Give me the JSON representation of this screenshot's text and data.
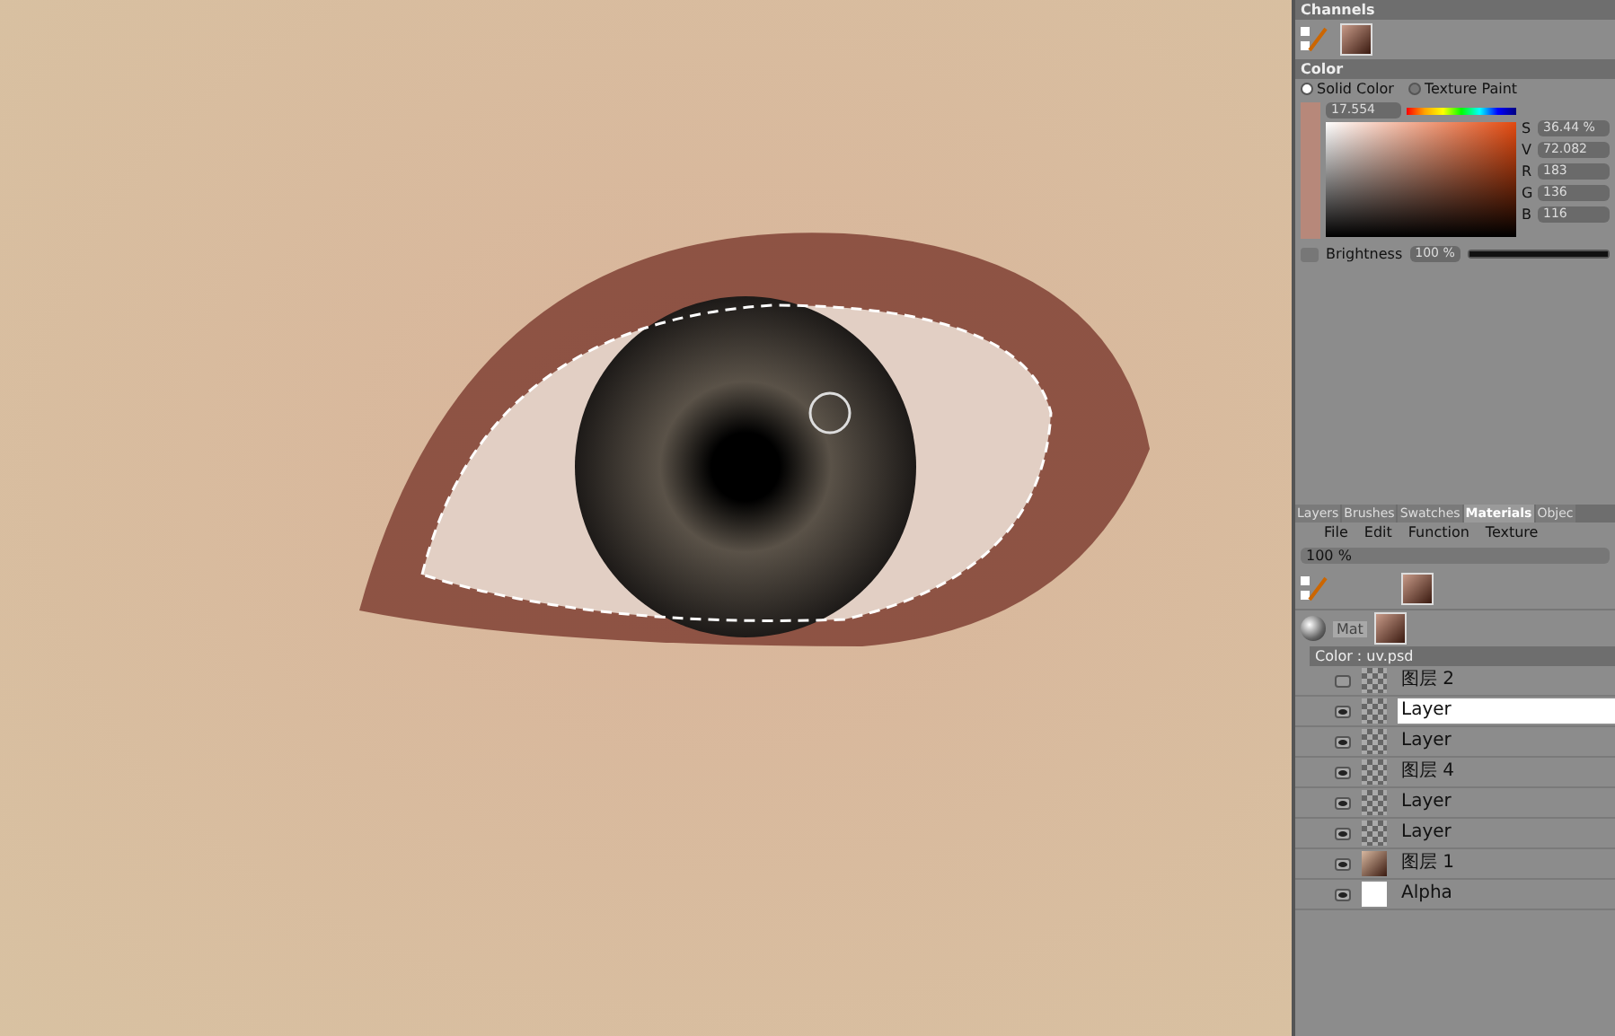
{
  "channels": {
    "title": "Channels"
  },
  "color": {
    "title": "Color",
    "modes": [
      {
        "label": "Solid Color",
        "selected": true
      },
      {
        "label": "Texture Paint",
        "selected": false
      }
    ],
    "hue": "17.554",
    "fields": [
      {
        "label": "S",
        "value": "36.44 %"
      },
      {
        "label": "V",
        "value": "72.082"
      },
      {
        "label": "R",
        "value": "183"
      },
      {
        "label": "G",
        "value": "136"
      },
      {
        "label": "B",
        "value": "116"
      }
    ],
    "brightness": {
      "label": "Brightness",
      "value": "100 %",
      "level": 1
    }
  },
  "tabs": [
    {
      "label": "Layers",
      "selected": false
    },
    {
      "label": "Brushes",
      "selected": false
    },
    {
      "label": "Swatches",
      "selected": false
    },
    {
      "label": "Materials",
      "selected": true
    },
    {
      "label": "Objec",
      "selected": false
    }
  ],
  "menu": [
    "File",
    "Edit",
    "Function",
    "Texture"
  ],
  "zoom": "100 %",
  "material": {
    "name": "Mat",
    "channel": "Color : uv.psd"
  },
  "layers": [
    {
      "name": "图层 2",
      "kind": "layer",
      "visible": false,
      "selected": false
    },
    {
      "name": "Layer",
      "kind": "layer",
      "visible": true,
      "selected": true
    },
    {
      "name": "Layer",
      "kind": "layer",
      "visible": true,
      "selected": false
    },
    {
      "name": "图层 4",
      "kind": "layer",
      "visible": true,
      "selected": false
    },
    {
      "name": "Layer",
      "kind": "layer",
      "visible": true,
      "selected": false
    },
    {
      "name": "Layer",
      "kind": "layer",
      "visible": true,
      "selected": false
    },
    {
      "name": "图层 1",
      "kind": "image",
      "visible": true,
      "selected": false
    },
    {
      "name": "Alpha",
      "kind": "alpha",
      "visible": true,
      "selected": false
    }
  ]
}
